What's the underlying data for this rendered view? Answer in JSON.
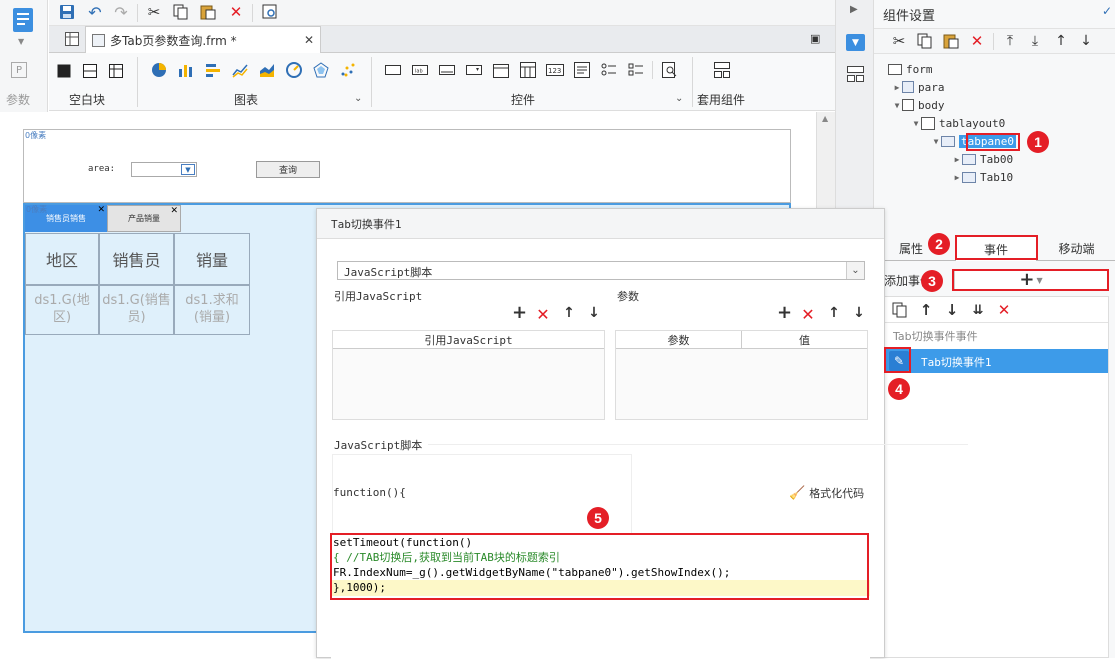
{
  "left_rail": {
    "param_label": "参数"
  },
  "tab": {
    "title": "多Tab页参数查询.frm *"
  },
  "ribbon": {
    "groups": [
      "空白块",
      "图表",
      "控件",
      "套用组件"
    ]
  },
  "canvas": {
    "top_block_label": "0像素",
    "area_label": "area:",
    "query_button": "查询",
    "tabpane_label": "0像素",
    "tabs": [
      "销售员销售",
      "产品销量"
    ],
    "table_headers": [
      "地区",
      "销售员",
      "销量"
    ],
    "table_cells": [
      "ds1.G(地区)",
      "ds1.G(销售员)",
      "ds1.求和(销量)"
    ]
  },
  "dialog": {
    "title": "Tab切换事件1",
    "type_select": "JavaScript脚本",
    "ref_js_label": "引用JavaScript",
    "params_label": "参数",
    "ref_js_col": "引用JavaScript",
    "param_col": "参数",
    "value_col": "值",
    "script_section": "JavaScript脚本",
    "function_header": "function(){",
    "format_code": "格式化代码",
    "code_lines": [
      "setTimeout(function()",
      "{ //TAB切换后,获取到当前TAB块的标题索引",
      "FR.IndexNum=_g().getWidgetByName(\"tabpane0\").getShowIndex();",
      "},1000);"
    ]
  },
  "right_panel": {
    "title": "组件设置",
    "tree": {
      "form": "form",
      "para": "para",
      "body": "body",
      "tablayout": "tablayout0",
      "tabpane": "tabpane0",
      "tab00": "Tab00",
      "tab10": "Tab10"
    },
    "tab_props": "属性",
    "tab_events": "事件",
    "tab_mobile": "移动端",
    "add_event_label": "添加事件",
    "event_group": "Tab切换事件事件",
    "event_item": "Tab切换事件1"
  },
  "callouts": [
    "1",
    "2",
    "3",
    "4",
    "5"
  ],
  "colors": {
    "accent_blue": "#3c8fe0",
    "selected_row": "#3d9be9",
    "callout_red": "#e41e26",
    "canvas_bg": "#dff0fb"
  }
}
